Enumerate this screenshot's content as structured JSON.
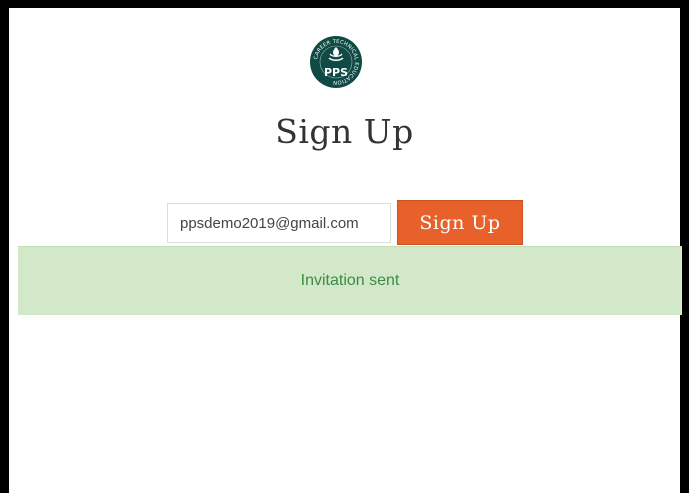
{
  "logo": {
    "ring_text": "CAREER TECHNICAL EDUCATION",
    "mark_text": "PPS",
    "color": "#0f4a44"
  },
  "page": {
    "title": "Sign Up"
  },
  "form": {
    "email_value": "ppsdemo2019@gmail.com",
    "submit_label": "Sign Up",
    "accent_color": "#e8612a"
  },
  "alert": {
    "message": "Invitation sent",
    "background": "#d2e8c9",
    "text_color": "#3d8b45"
  }
}
